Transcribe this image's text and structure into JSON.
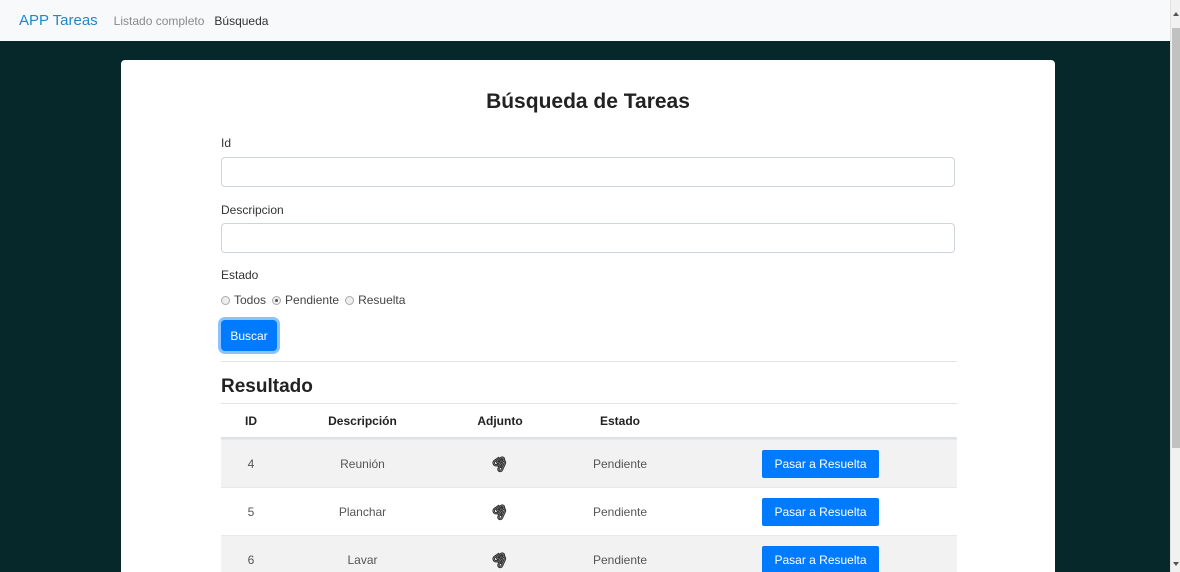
{
  "navbar": {
    "brand": "APP Tareas",
    "links": [
      {
        "label": "Listado completo",
        "active": false
      },
      {
        "label": "Búsqueda",
        "active": true
      }
    ]
  },
  "form": {
    "title": "Búsqueda de Tareas",
    "id_label": "Id",
    "id_value": "",
    "desc_label": "Descripcion",
    "desc_value": "",
    "estado_label": "Estado",
    "estado_options": [
      "Todos",
      "Pendiente",
      "Resuelta"
    ],
    "estado_selected": "Pendiente",
    "search_button": "Buscar"
  },
  "results": {
    "title": "Resultado",
    "headers": [
      "ID",
      "Descripción",
      "Adjunto",
      "Estado",
      ""
    ],
    "attachment_icon": "paperclip-icon",
    "rows": [
      {
        "id": "4",
        "descripcion": "Reunión",
        "estado": "Pendiente",
        "action": "Pasar a Resuelta"
      },
      {
        "id": "5",
        "descripcion": "Planchar",
        "estado": "Pendiente",
        "action": "Pasar a Resuelta"
      },
      {
        "id": "6",
        "descripcion": "Lavar",
        "estado": "Pendiente",
        "action": "Pasar a Resuelta"
      }
    ]
  },
  "colors": {
    "background": "#06282a",
    "primary": "#007bff",
    "brand": "#1e88c9"
  }
}
